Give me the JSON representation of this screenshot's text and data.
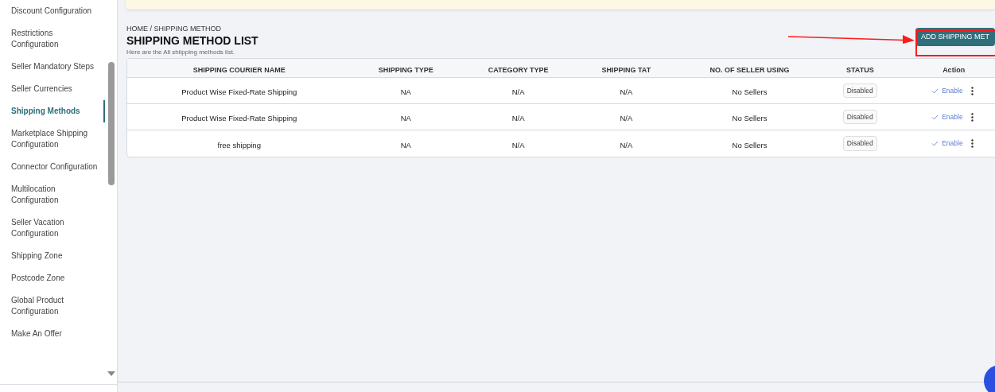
{
  "sidebar": {
    "items": [
      {
        "label": "Discount Configuration",
        "selected": false
      },
      {
        "label": "Restrictions Configuration",
        "selected": false
      },
      {
        "label": "Seller Mandatory Steps",
        "selected": false
      },
      {
        "label": "Seller Currencies",
        "selected": false
      },
      {
        "label": "Shipping Methods",
        "selected": true
      },
      {
        "label": "Marketplace Shipping Configuration",
        "selected": false
      },
      {
        "label": "Connector Configuration",
        "selected": false
      },
      {
        "label": "Multilocation Configuration",
        "selected": false
      },
      {
        "label": "Seller Vacation Configuration",
        "selected": false
      },
      {
        "label": "Shipping Zone",
        "selected": false
      },
      {
        "label": "Postcode Zone",
        "selected": false
      },
      {
        "label": "Global Product Configuration",
        "selected": false
      },
      {
        "label": "Make An Offer",
        "selected": false
      }
    ]
  },
  "breadcrumb": "HOME / SHIPPING METHOD",
  "title": "SHIPPING METHOD LIST",
  "subtitle": "Here are the All shiipping methods list.",
  "add_button": "ADD SHIPPING MET",
  "table": {
    "columns": [
      "SHIPPING COURIER NAME",
      "SHIPPING TYPE",
      "CATEGORY TYPE",
      "SHIPPING TAT",
      "NO. OF SELLER USING",
      "STATUS",
      "Action"
    ],
    "rows": [
      {
        "name": "Product Wise Fixed-Rate Shipping",
        "shipping_type": "NA",
        "category_type": "N/A",
        "shipping_tat": "N/A",
        "sellers": "No Sellers",
        "status": "Disabled",
        "action": "Enable"
      },
      {
        "name": "Product Wise Fixed-Rate Shipping",
        "shipping_type": "NA",
        "category_type": "N/A",
        "shipping_tat": "N/A",
        "sellers": "No Sellers",
        "status": "Disabled",
        "action": "Enable"
      },
      {
        "name": "free shipping",
        "shipping_type": "NA",
        "category_type": "N/A",
        "shipping_tat": "N/A",
        "sellers": "No Sellers",
        "status": "Disabled",
        "action": "Enable"
      }
    ]
  }
}
